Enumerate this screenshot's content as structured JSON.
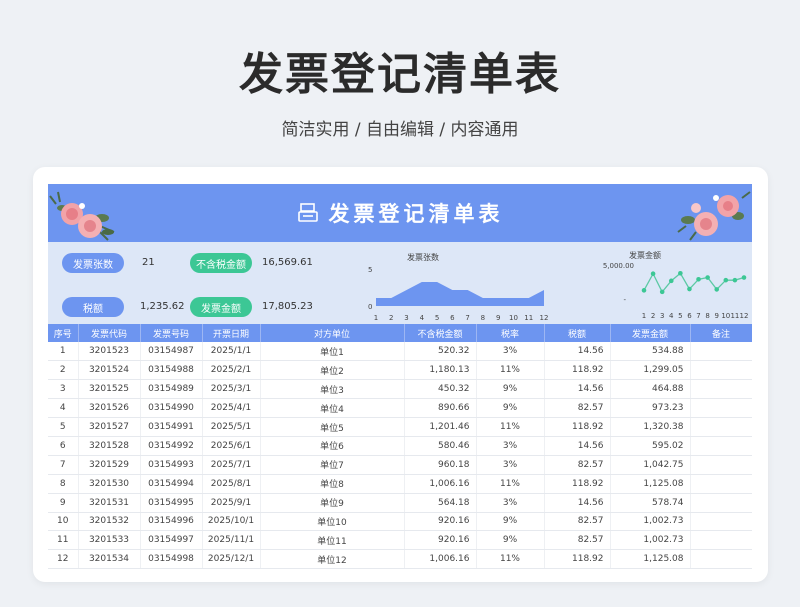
{
  "header": {
    "title": "发票登记清单表",
    "subtitle": "简洁实用 / 自由编辑 / 内容通用"
  },
  "sheet": {
    "title": "发票登记清单表",
    "colors": {
      "accent": "#6d95f0",
      "green": "#3cc795",
      "panel": "#dde7f7",
      "line": "#5cc9a4"
    }
  },
  "stats": {
    "count_label": "发票张数",
    "count_value": "21",
    "pretax_label": "不含税金额",
    "pretax_value": "16,569.61",
    "tax_label": "税额",
    "tax_value": "1,235.62",
    "amount_label": "发票金额",
    "amount_value": "17,805.23"
  },
  "chart_data": [
    {
      "type": "area",
      "title": "发票张数",
      "x": [
        "1",
        "2",
        "3",
        "4",
        "5",
        "6",
        "7",
        "8",
        "9",
        "10",
        "11",
        "12"
      ],
      "y_ticks": [
        "5",
        "0"
      ],
      "values": [
        1,
        1,
        2,
        3,
        3,
        2,
        2,
        1,
        1,
        1,
        1,
        2
      ],
      "ylim": [
        0,
        5
      ]
    },
    {
      "type": "line",
      "title": "发票金额",
      "x": [
        "1",
        "2",
        "3",
        "4",
        "5",
        "6",
        "7",
        "8",
        "9",
        "10",
        "11",
        "12"
      ],
      "y_ticks": [
        "5,000.00",
        "-"
      ],
      "values": [
        534.88,
        1299.05,
        464.88,
        973.23,
        1320.38,
        595.02,
        1042.75,
        1125.08,
        578.74,
        1002.73,
        1002.73,
        1125.08
      ],
      "ylim": [
        0,
        5000
      ]
    }
  ],
  "table": {
    "columns": [
      "序号",
      "发票代码",
      "发票号码",
      "开票日期",
      "对方单位",
      "不含税金额",
      "税率",
      "税额",
      "发票金额",
      "备注"
    ],
    "rows": [
      [
        "1",
        "3201523",
        "03154987",
        "2025/1/1",
        "单位1",
        "520.32",
        "3%",
        "14.56",
        "534.88",
        ""
      ],
      [
        "2",
        "3201524",
        "03154988",
        "2025/2/1",
        "单位2",
        "1,180.13",
        "11%",
        "118.92",
        "1,299.05",
        ""
      ],
      [
        "3",
        "3201525",
        "03154989",
        "2025/3/1",
        "单位3",
        "450.32",
        "9%",
        "14.56",
        "464.88",
        ""
      ],
      [
        "4",
        "3201526",
        "03154990",
        "2025/4/1",
        "单位4",
        "890.66",
        "9%",
        "82.57",
        "973.23",
        ""
      ],
      [
        "5",
        "3201527",
        "03154991",
        "2025/5/1",
        "单位5",
        "1,201.46",
        "11%",
        "118.92",
        "1,320.38",
        ""
      ],
      [
        "6",
        "3201528",
        "03154992",
        "2025/6/1",
        "单位6",
        "580.46",
        "3%",
        "14.56",
        "595.02",
        ""
      ],
      [
        "7",
        "3201529",
        "03154993",
        "2025/7/1",
        "单位7",
        "960.18",
        "3%",
        "82.57",
        "1,042.75",
        ""
      ],
      [
        "8",
        "3201530",
        "03154994",
        "2025/8/1",
        "单位8",
        "1,006.16",
        "11%",
        "118.92",
        "1,125.08",
        ""
      ],
      [
        "9",
        "3201531",
        "03154995",
        "2025/9/1",
        "单位9",
        "564.18",
        "3%",
        "14.56",
        "578.74",
        ""
      ],
      [
        "10",
        "3201532",
        "03154996",
        "2025/10/1",
        "单位10",
        "920.16",
        "9%",
        "82.57",
        "1,002.73",
        ""
      ],
      [
        "11",
        "3201533",
        "03154997",
        "2025/11/1",
        "单位11",
        "920.16",
        "9%",
        "82.57",
        "1,002.73",
        ""
      ],
      [
        "12",
        "3201534",
        "03154998",
        "2025/12/1",
        "单位12",
        "1,006.16",
        "11%",
        "118.92",
        "1,125.08",
        ""
      ]
    ]
  }
}
